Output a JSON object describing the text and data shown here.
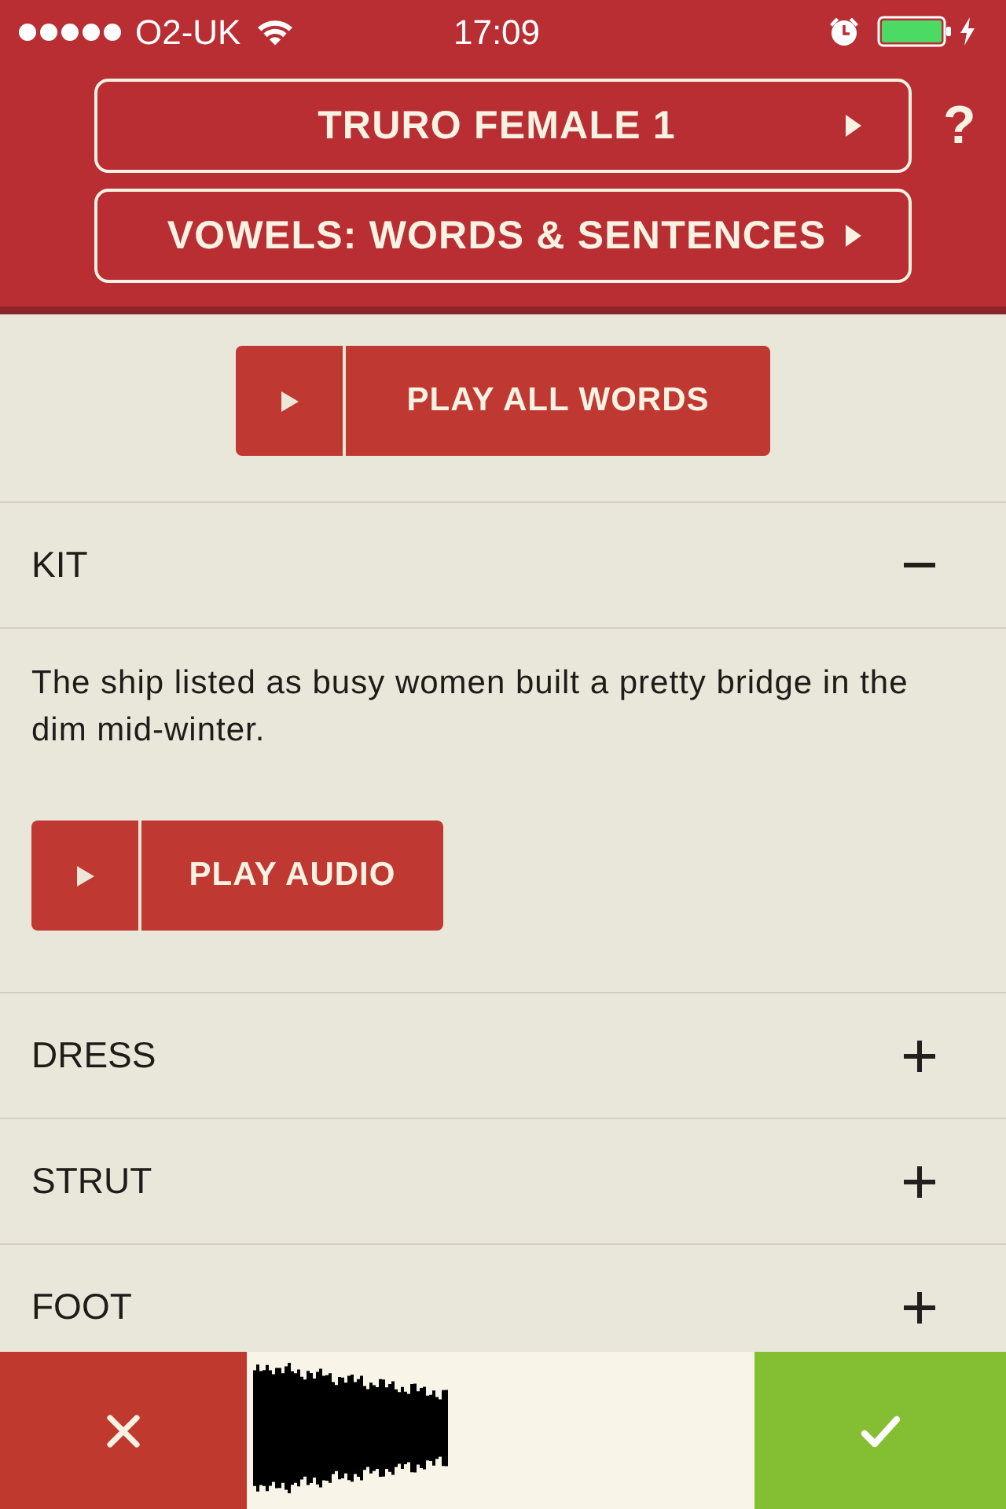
{
  "status_bar": {
    "carrier": "O2-UK",
    "time": "17:09",
    "alarm": true,
    "charging": true
  },
  "header": {
    "selectors": [
      {
        "label": "TRURO FEMALE 1"
      },
      {
        "label": "VOWELS: WORDS & SENTENCES"
      }
    ],
    "help": "?"
  },
  "play_all_button": {
    "label": "PLAY ALL WORDS"
  },
  "sections": [
    {
      "title": "KIT",
      "expanded": true,
      "text": "The ship listed as busy women built a pretty bridge in the dim mid-winter.",
      "play_button": {
        "label": "PLAY AUDIO"
      }
    },
    {
      "title": "DRESS",
      "expanded": false
    },
    {
      "title": "STRUT",
      "expanded": false
    },
    {
      "title": "FOOT",
      "expanded": false
    }
  ],
  "recorder": {
    "recorded": true
  }
}
